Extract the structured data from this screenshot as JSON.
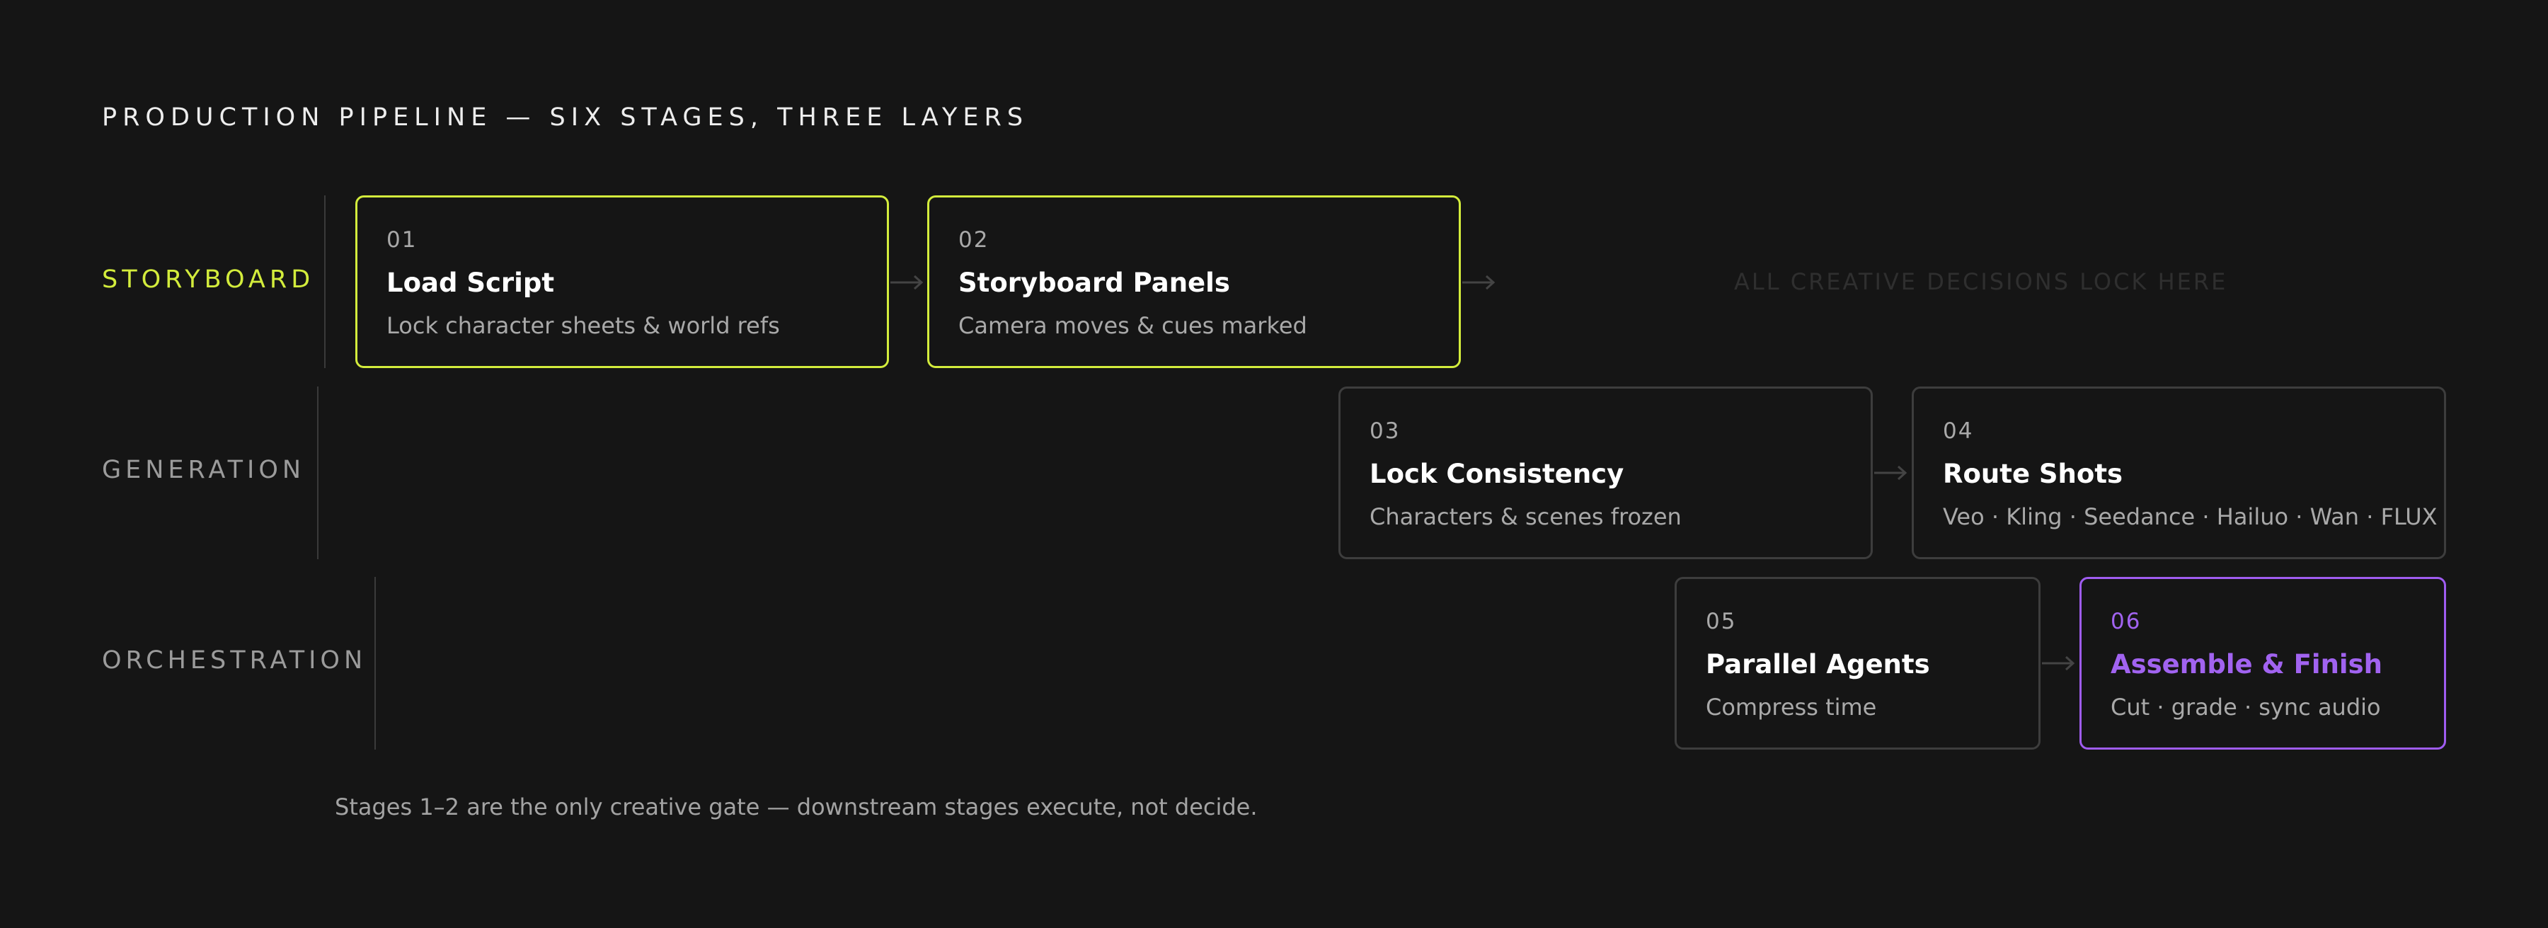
{
  "title": "PRODUCTION PIPELINE — SIX STAGES, THREE LAYERS",
  "layers": {
    "storyboard": "STORYBOARD",
    "generation": "GENERATION",
    "orchestration": "ORCHESTRATION"
  },
  "stages": [
    {
      "num": "01",
      "name": "Load Script",
      "desc": "Lock character sheets & world refs"
    },
    {
      "num": "02",
      "name": "Storyboard Panels",
      "desc": "Camera moves & cues marked"
    },
    {
      "num": "03",
      "name": "Lock Consistency",
      "desc": "Characters & scenes frozen"
    },
    {
      "num": "04",
      "name": "Route Shots",
      "desc": "Veo · Kling · Seedance · Hailuo · Wan · FLUX"
    },
    {
      "num": "05",
      "name": "Parallel Agents",
      "desc": "Compress time"
    },
    {
      "num": "06",
      "name": "Assemble & Finish",
      "desc": "Cut · grade · sync audio"
    }
  ],
  "lock_note": "ALL CREATIVE DECISIONS LOCK HERE",
  "footnote": "Stages 1–2 are the only creative gate — downstream stages execute, not decide.",
  "colors": {
    "background": "#151515",
    "storyboard_accent": "#d3ec3c",
    "finish_accent": "#9f5cf0",
    "card_border": "#3d3d3d",
    "muted_text": "#a9a9a9"
  }
}
